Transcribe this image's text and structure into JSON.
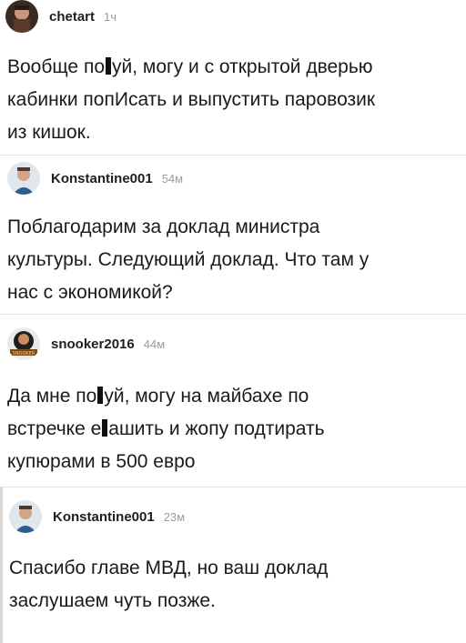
{
  "comments": [
    {
      "username": "chetart",
      "time": "1ч",
      "line1_a": "Вообще по",
      "line1_b": "уй, могу и с открытой дверью",
      "line2": "кабинки попИсать и выпустить паровозик",
      "line3": "из кишок."
    },
    {
      "username": "Konstantine001",
      "time": "54м",
      "line1": "Поблагодарим за доклад министра",
      "line2": "культуры. Следующий доклад. Что там у",
      "line3": "нас с экономикой?"
    },
    {
      "username": "snooker2016",
      "time": "44м",
      "line1_a": "Да мне по",
      "line1_b": "уй, могу на майбахе по",
      "line2_a": "встречке е",
      "line2_b": "ашить и жопу подтирать",
      "line3": "купюрами в 500 евро",
      "avatar_text": "SNOOKER"
    },
    {
      "username": "Konstantine001",
      "time": "23м",
      "line1": "Спасибо главе МВД, но ваш доклад",
      "line2": "заслушаем чуть позже."
    }
  ]
}
